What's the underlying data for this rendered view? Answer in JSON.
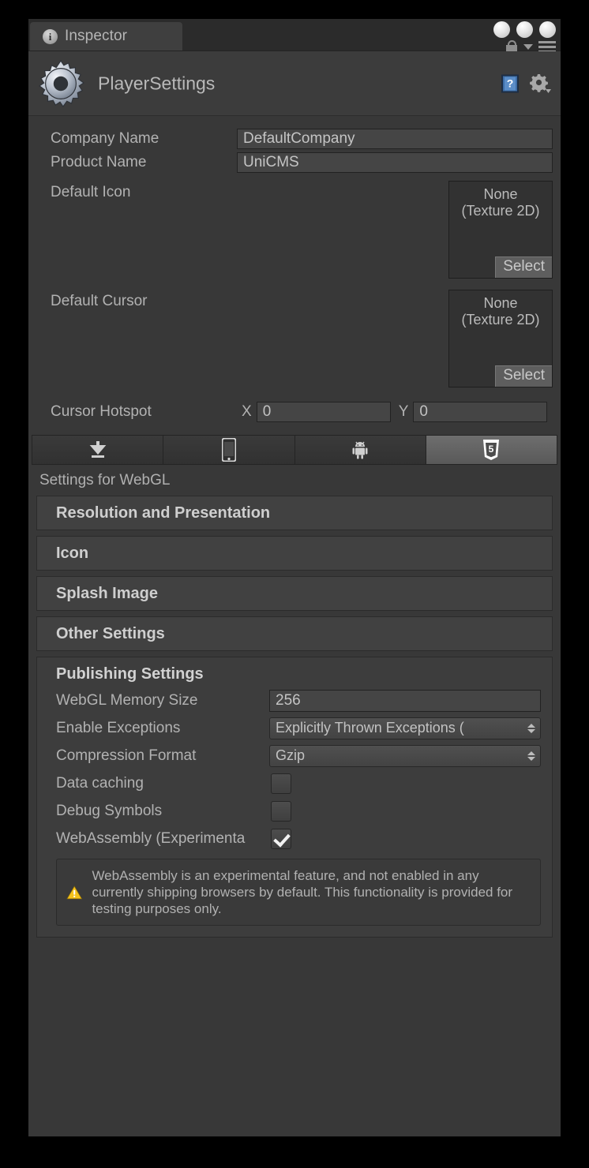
{
  "window": {
    "tab_label": "Inspector",
    "tab_icon": "info-circle-icon",
    "controls": {
      "lock": "lock-icon",
      "menu": "hamburger-menu-icon",
      "caret": "chevron-down-icon"
    }
  },
  "object_header": {
    "icon": "gear-icon",
    "title": "PlayerSettings",
    "help_icon": "help-book-icon",
    "settings_icon": "gear-dropdown-icon"
  },
  "cross_platform": {
    "company_name": {
      "label": "Company Name",
      "value": "DefaultCompany"
    },
    "product_name": {
      "label": "Product Name",
      "value": "UniCMS"
    },
    "default_icon": {
      "label": "Default Icon",
      "value_line1": "None",
      "value_line2": "(Texture 2D)",
      "select_label": "Select"
    },
    "default_cursor": {
      "label": "Default Cursor",
      "value_line1": "None",
      "value_line2": "(Texture 2D)",
      "select_label": "Select"
    },
    "cursor_hotspot": {
      "label": "Cursor Hotspot",
      "x_label": "X",
      "x_value": "0",
      "y_label": "Y",
      "y_value": "0"
    }
  },
  "platform_tabs": [
    {
      "name": "standalone",
      "icon": "download-arrow-icon",
      "active": false
    },
    {
      "name": "ios",
      "icon": "phone-icon",
      "active": false
    },
    {
      "name": "android",
      "icon": "android-robot-icon",
      "active": false
    },
    {
      "name": "webgl",
      "icon": "html5-shield-icon",
      "active": true
    }
  ],
  "settings_for": "Settings for WebGL",
  "sections": [
    {
      "title": "Resolution and Presentation"
    },
    {
      "title": "Icon"
    },
    {
      "title": "Splash Image"
    },
    {
      "title": "Other Settings"
    }
  ],
  "publishing": {
    "title": "Publishing Settings",
    "memory_size": {
      "label": "WebGL Memory Size",
      "value": "256"
    },
    "enable_exceptions": {
      "label": "Enable Exceptions",
      "value": "Explicitly Thrown Exceptions ("
    },
    "compression_format": {
      "label": "Compression Format",
      "value": "Gzip"
    },
    "data_caching": {
      "label": "Data caching",
      "checked": false
    },
    "debug_symbols": {
      "label": "Debug Symbols",
      "checked": false
    },
    "webassembly": {
      "label": "WebAssembly (Experimenta",
      "checked": true
    },
    "warning": {
      "icon": "warning-triangle-icon",
      "text": "WebAssembly is an experimental feature, and not enabled in any currently shipping browsers by default. This functionality is provided for testing purposes only."
    }
  },
  "colors": {
    "panel_bg": "#383838",
    "header_bg": "#3c3c3c",
    "field_bg": "#454545",
    "accent_warning": "#f5c21b",
    "help_blue": "#3a6ea5"
  }
}
